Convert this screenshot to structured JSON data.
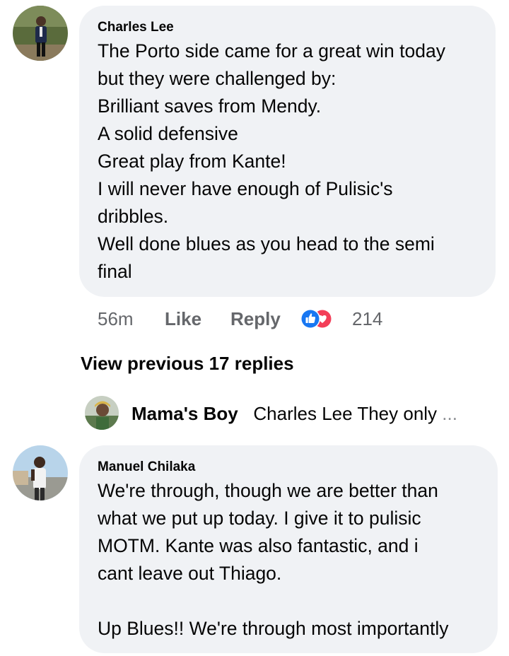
{
  "comments": [
    {
      "author": "Charles Lee",
      "text": "The Porto side came for a great win today\nbut they were challenged by:\nBrilliant saves from Mendy.\nA solid defensive\nGreat play from Kante!\nI will never have enough of Pulisic's\ndribbles.\nWell done blues as you head to the semi\nfinal",
      "time": "56m",
      "like_label": "Like",
      "reply_label": "Reply",
      "reaction_icons": [
        "like-icon",
        "love-icon"
      ],
      "reaction_count": "214"
    },
    {
      "author": "Manuel Chilaka",
      "text": "We're through, though we are better than\nwhat we put up today. I give it to pulisic\nMOTM. Kante was also fantastic, and i\ncant leave out Thiago.\n\nUp Blues!! We're through most importantly"
    }
  ],
  "view_previous": "View previous 17 replies",
  "reply_preview": {
    "author": "Mama's Boy",
    "text": "Charles Lee They only",
    "ellipsis": "..."
  },
  "colors": {
    "bubble": "#f0f2f5",
    "meta": "#65676b",
    "like_blue": "#1877f2",
    "love_red": "#f33e58"
  }
}
